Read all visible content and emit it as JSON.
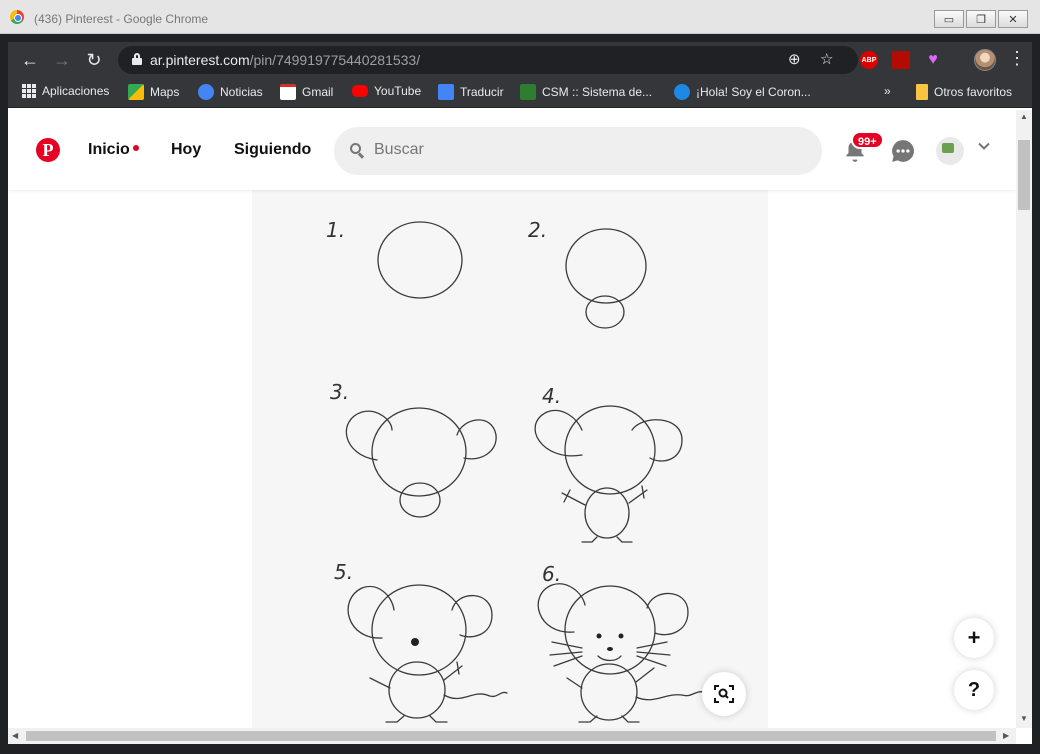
{
  "window": {
    "title": "(436) Pinterest - Google Chrome",
    "controls": [
      "▭",
      "❐",
      "✕"
    ]
  },
  "toolbar": {
    "url_host": "ar.pinterest.com",
    "url_path": "/pin/749919775440281533/",
    "extensions": [
      "ABP"
    ]
  },
  "bookmarks": [
    {
      "label": "Aplicaciones",
      "icon": "apps-icon"
    },
    {
      "label": "Maps",
      "icon": "maps-icon"
    },
    {
      "label": "Noticias",
      "icon": "news-icon"
    },
    {
      "label": "Gmail",
      "icon": "gmail-icon"
    },
    {
      "label": "YouTube",
      "icon": "youtube-icon"
    },
    {
      "label": "Traducir",
      "icon": "translate-icon"
    },
    {
      "label": "CSM :: Sistema de...",
      "icon": "csm-icon"
    },
    {
      "label": "¡Hola! Soy el Coron...",
      "icon": "hola-icon"
    }
  ],
  "bookmarks_overflow": "»",
  "other_bookmarks": "Otros favoritos",
  "header": {
    "nav": [
      {
        "label": "Inicio"
      },
      {
        "label": "Hoy"
      },
      {
        "label": "Siguiendo"
      }
    ],
    "search_placeholder": "Buscar",
    "notification_badge": "99+"
  },
  "pin": {
    "steps": [
      "1.",
      "2.",
      "3.",
      "4.",
      "5.",
      "6."
    ]
  },
  "floating": {
    "add_label": "+",
    "help_label": "?"
  },
  "colors": {
    "brand": "#e60023",
    "chrome_dark": "#35363a"
  }
}
